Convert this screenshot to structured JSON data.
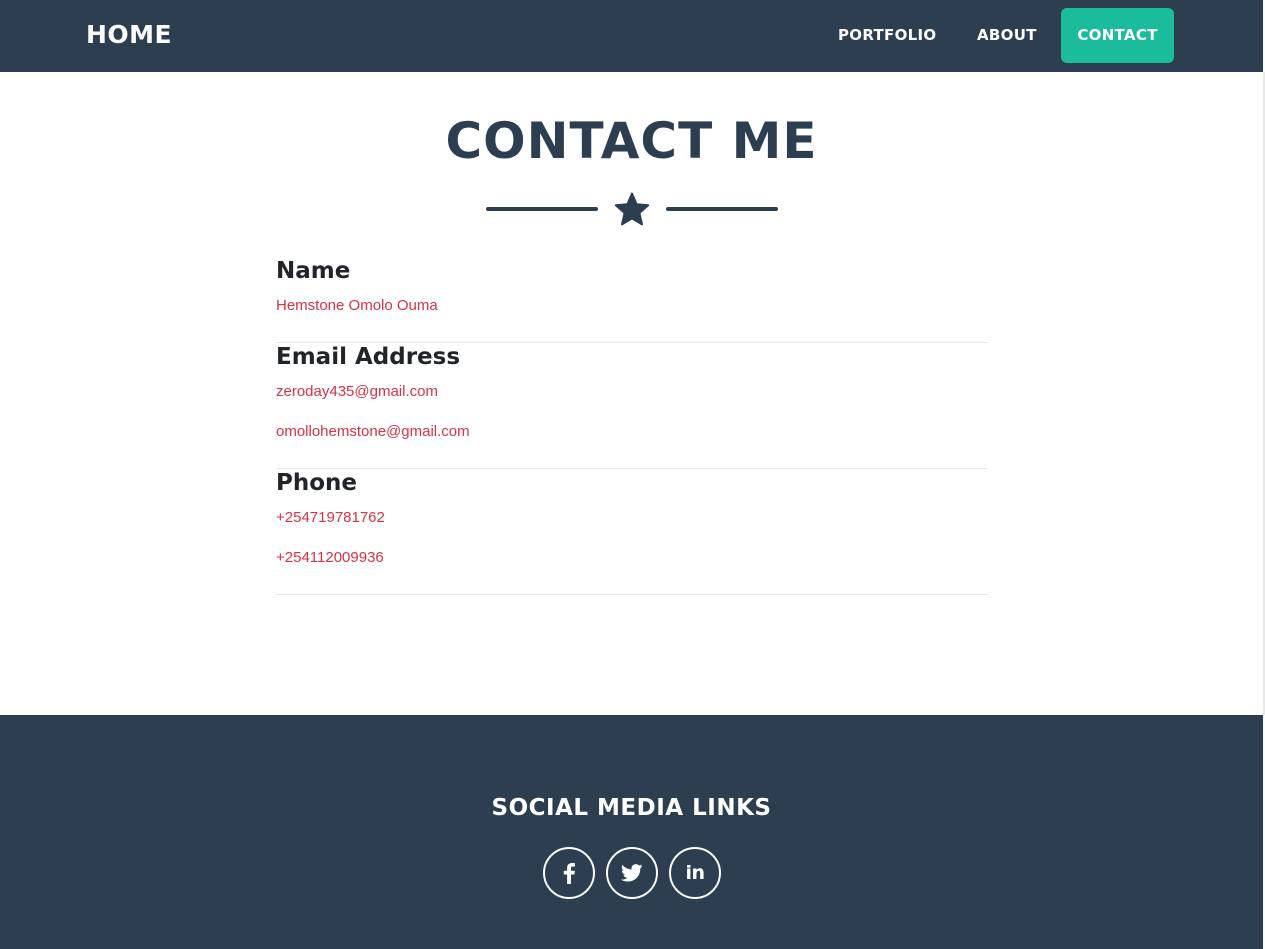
{
  "navbar": {
    "brand": "HOME",
    "links": [
      {
        "label": "PORTFOLIO"
      },
      {
        "label": "ABOUT"
      },
      {
        "label": "CONTACT",
        "active": true
      }
    ]
  },
  "contact": {
    "title": "CONTACT ME",
    "divider_icon": "star-icon",
    "groups": [
      {
        "heading": "Name",
        "values": [
          "Hemstone Omolo Ouma"
        ]
      },
      {
        "heading": "Email Address",
        "values": [
          "zeroday435@gmail.com",
          "omollohemstone@gmail.com"
        ]
      },
      {
        "heading": "Phone",
        "values": [
          "+254719781762",
          "+254112009936"
        ]
      }
    ]
  },
  "footer": {
    "title": "SOCIAL MEDIA LINKS",
    "social": [
      {
        "icon": "facebook-icon"
      },
      {
        "icon": "twitter-icon"
      },
      {
        "icon": "linkedin-icon",
        "glyph": "in"
      }
    ]
  },
  "colors": {
    "primary": "#2c3e50",
    "accent": "#1abc9c",
    "link": "#d63344",
    "heading_text": "#212529"
  }
}
